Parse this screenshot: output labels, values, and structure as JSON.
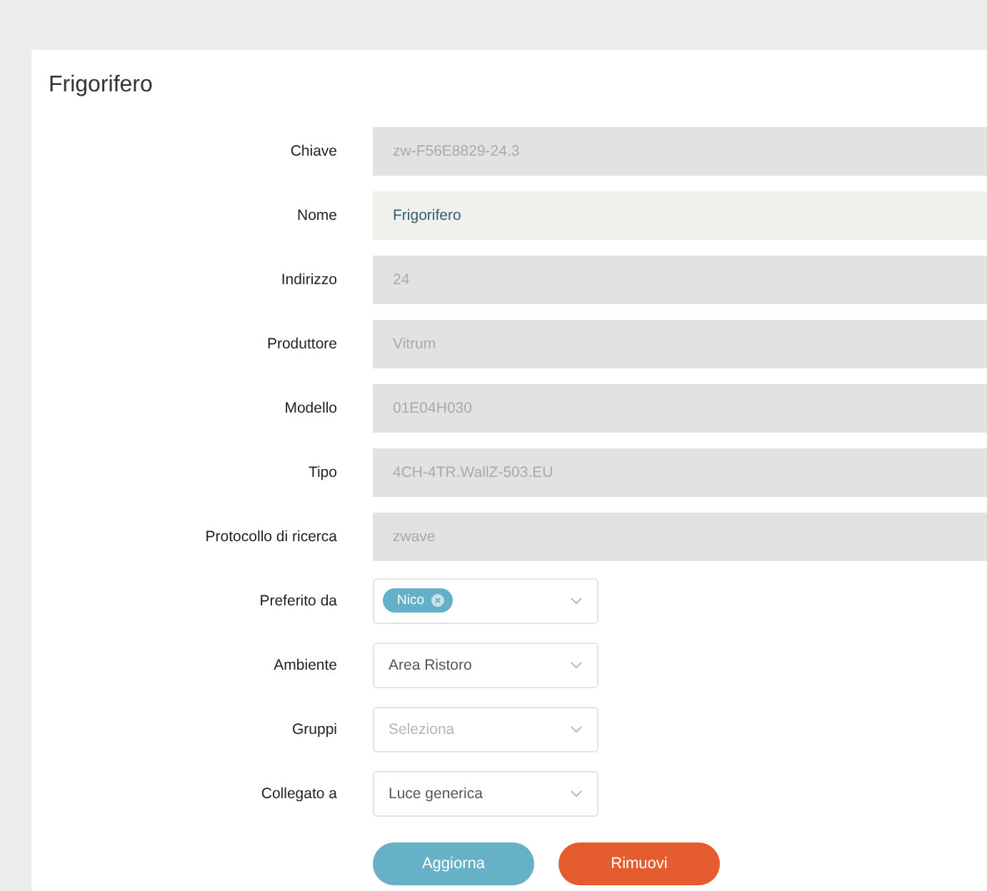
{
  "card": {
    "title": "Frigorifero"
  },
  "fields": [
    {
      "kind": "text",
      "label": "Chiave",
      "value": "zw-F56E8829-24.3",
      "disabled": true
    },
    {
      "kind": "text",
      "label": "Nome",
      "value": "Frigorifero",
      "disabled": false
    },
    {
      "kind": "text",
      "label": "Indirizzo",
      "value": "24",
      "disabled": true
    },
    {
      "kind": "text",
      "label": "Produttore",
      "value": "Vitrum",
      "disabled": true
    },
    {
      "kind": "text",
      "label": "Modello",
      "value": "01E04H030",
      "disabled": true
    },
    {
      "kind": "text",
      "label": "Tipo",
      "value": "4CH-4TR.WallZ-503.EU",
      "disabled": true
    },
    {
      "kind": "text",
      "label": "Protocollo di ricerca",
      "value": "zwave",
      "disabled": true
    },
    {
      "kind": "tags",
      "label": "Preferito da",
      "tags": [
        "Nico"
      ]
    },
    {
      "kind": "select",
      "label": "Ambiente",
      "value": "Area Ristoro"
    },
    {
      "kind": "select",
      "label": "Gruppi",
      "placeholder": "Seleziona"
    },
    {
      "kind": "select",
      "label": "Collegato a",
      "value": "Luce generica"
    }
  ],
  "buttons": [
    {
      "label": "Aggiorna",
      "kind": "primary"
    },
    {
      "label": "Rimuovi",
      "kind": "danger"
    }
  ]
}
